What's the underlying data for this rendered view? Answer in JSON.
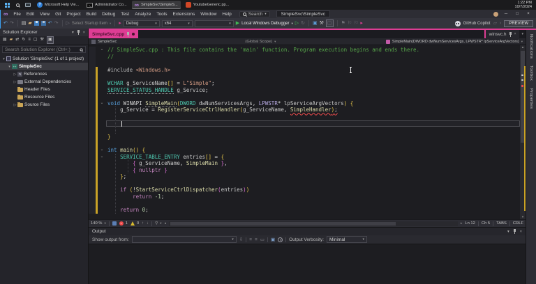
{
  "taskbar": {
    "apps": [
      {
        "label": "Microsoft Help Vie...",
        "icon": "help-viewer",
        "active": false
      },
      {
        "label": "Administrator Co...",
        "icon": "console",
        "active": false
      },
      {
        "label": "SimpleSvc\\SimpleS...",
        "icon": "visual-studio",
        "active": true
      },
      {
        "label": "YoutubeGeneric.pp...",
        "icon": "red-app",
        "active": false
      }
    ],
    "clock": {
      "time": "1:22 PM",
      "date": "10/7/2024"
    }
  },
  "titlebar": {
    "menus": [
      "File",
      "Edit",
      "View",
      "Git",
      "Project",
      "Build",
      "Debug",
      "Test",
      "Analyze",
      "Tools",
      "Extensions",
      "Window",
      "Help"
    ],
    "search_label": "Search",
    "window_title": "SimpleSvc\\SimpleSvc"
  },
  "toolbar": {
    "select_startup": "Select Startup Item",
    "config": "Debug",
    "platform": "x64",
    "run": "Local Windows Debugger",
    "copilot": "GitHub Copilot",
    "preview": "PREVIEW"
  },
  "solution_explorer": {
    "title": "Solution Explorer",
    "search_placeholder": "Search Solution Explorer (Ctrl+;)",
    "tree": [
      {
        "label": "Solution 'SimpleSvc' (1 of 1 project)",
        "icon": "solution",
        "indent": 0,
        "chevron": "down",
        "selected": false
      },
      {
        "label": "SimpleSvc",
        "icon": "cpp-project",
        "indent": 1,
        "chevron": "down",
        "selected": true
      },
      {
        "label": "References",
        "icon": "references",
        "indent": 2,
        "chevron": "right",
        "selected": false
      },
      {
        "label": "External Dependencies",
        "icon": "external-deps",
        "indent": 2,
        "chevron": "right",
        "selected": false
      },
      {
        "label": "Header Files",
        "icon": "folder",
        "indent": 2,
        "chevron": "none",
        "selected": false
      },
      {
        "label": "Resource Files",
        "icon": "folder",
        "indent": 2,
        "chevron": "none",
        "selected": false
      },
      {
        "label": "Source Files",
        "icon": "folder",
        "indent": 2,
        "chevron": "right",
        "selected": false
      }
    ]
  },
  "editor": {
    "tabs": {
      "active": "SimpleSvc.cpp",
      "preview": "winsvc.h"
    },
    "breadcrumb": {
      "project": "SimpleSvc",
      "scope": "(Global Scope)",
      "member": "SimpleMain(DWORD dwNumServicesArgs, LPWSTR* lpServiceArgVectors)"
    },
    "lines": [
      {
        "fold": true,
        "ch": false,
        "t": [
          [
            "c",
            "// SimpleSvc.cpp : This file contains the 'main' function. Program execution begins and ends there."
          ]
        ]
      },
      {
        "ch": false,
        "t": [
          [
            "c",
            "//"
          ]
        ]
      },
      {
        "ch": false,
        "t": []
      },
      {
        "ch": true,
        "t": [
          [
            "pp",
            "#include "
          ],
          [
            "s",
            "<Windows.h>"
          ]
        ]
      },
      {
        "ch": true,
        "t": []
      },
      {
        "ch": true,
        "t": [
          [
            "t",
            "WCHAR"
          ],
          [
            "p",
            " "
          ],
          [
            "id",
            "g_ServiceName"
          ],
          [
            "b1",
            "[]"
          ],
          [
            "p",
            " = "
          ],
          [
            "s",
            "L\"Simple\""
          ],
          [
            "p",
            ";"
          ]
        ]
      },
      {
        "ch": true,
        "t": [
          [
            "t u2",
            "SERVICE_STATUS_HANDLE"
          ],
          [
            "p",
            " "
          ],
          [
            "id",
            "g_Service"
          ],
          [
            "p",
            ";"
          ]
        ]
      },
      {
        "ch": true,
        "t": []
      },
      {
        "fold": true,
        "ch": true,
        "t": [
          [
            "k",
            "void"
          ],
          [
            "p",
            " WINAPI "
          ],
          [
            "f u2",
            "SimpleMain"
          ],
          [
            "b1",
            "("
          ],
          [
            "t",
            "DWORD"
          ],
          [
            "p",
            " "
          ],
          [
            "id",
            "dwNumServicesArgs"
          ],
          [
            "p",
            ", "
          ],
          [
            "m",
            "LPWSTR"
          ],
          [
            "p",
            "* "
          ],
          [
            "id",
            "lpServiceArgVectors"
          ],
          [
            "b1",
            ")"
          ],
          [
            "p",
            " "
          ],
          [
            "b1",
            "{"
          ]
        ]
      },
      {
        "ch": true,
        "t": [
          [
            "p",
            "    "
          ],
          [
            "id",
            "g_Service"
          ],
          [
            "p",
            " = "
          ],
          [
            "f",
            "RegisterServiceCtrlHandler"
          ],
          [
            "b1",
            "("
          ],
          [
            "id",
            "g_ServiceName"
          ],
          [
            "p",
            ", "
          ],
          [
            "f uerr",
            "SimpleHandler"
          ],
          [
            "b1 uerr",
            ")"
          ],
          [
            "p uerr",
            ";"
          ]
        ]
      },
      {
        "ch": true,
        "t": []
      },
      {
        "ch": true,
        "caret": true,
        "t": []
      },
      {
        "ch": true,
        "t": []
      },
      {
        "ch": true,
        "t": [
          [
            "b1",
            "}"
          ]
        ]
      },
      {
        "ch": true,
        "t": []
      },
      {
        "fold": true,
        "ch": true,
        "t": [
          [
            "k",
            "int"
          ],
          [
            "p",
            " "
          ],
          [
            "f",
            "main"
          ],
          [
            "b1",
            "()"
          ],
          [
            "p",
            " "
          ],
          [
            "b1",
            "{"
          ]
        ]
      },
      {
        "fold": true,
        "ch": true,
        "t": [
          [
            "p",
            "    "
          ],
          [
            "t",
            "SERVICE_TABLE_ENTRY"
          ],
          [
            "p",
            " "
          ],
          [
            "id",
            "entries"
          ],
          [
            "b1",
            "[]"
          ],
          [
            "p",
            " = "
          ],
          [
            "b1",
            "{"
          ]
        ]
      },
      {
        "ch": true,
        "t": [
          [
            "p",
            "        "
          ],
          [
            "b2",
            "{"
          ],
          [
            "p",
            " "
          ],
          [
            "id",
            "g_ServiceName"
          ],
          [
            "p",
            ", "
          ],
          [
            "f",
            "SimpleMain"
          ],
          [
            "p",
            " "
          ],
          [
            "b2",
            "}"
          ],
          [
            "p",
            ","
          ]
        ]
      },
      {
        "ch": true,
        "t": [
          [
            "p",
            "        "
          ],
          [
            "b2",
            "{"
          ],
          [
            "p",
            " "
          ],
          [
            "ctl",
            "nullptr"
          ],
          [
            "p",
            " "
          ],
          [
            "b2",
            "}"
          ]
        ]
      },
      {
        "ch": true,
        "t": [
          [
            "p",
            "    "
          ],
          [
            "b1",
            "}"
          ],
          [
            "p",
            ";"
          ]
        ]
      },
      {
        "ch": true,
        "t": []
      },
      {
        "ch": true,
        "t": [
          [
            "p",
            "    "
          ],
          [
            "ctl",
            "if"
          ],
          [
            "p",
            " "
          ],
          [
            "b1",
            "("
          ],
          [
            "p",
            "!"
          ],
          [
            "f",
            "StartServiceCtrlDispatcher"
          ],
          [
            "b2",
            "("
          ],
          [
            "id",
            "entries"
          ],
          [
            "b2",
            ")"
          ],
          [
            "b1",
            ")"
          ]
        ]
      },
      {
        "ch": true,
        "t": [
          [
            "p",
            "        "
          ],
          [
            "ctl",
            "return"
          ],
          [
            "p",
            " "
          ],
          [
            "n",
            "-1"
          ],
          [
            "p",
            ";"
          ]
        ]
      },
      {
        "ch": true,
        "t": []
      },
      {
        "ch": true,
        "t": [
          [
            "p",
            "    "
          ],
          [
            "ctl",
            "return"
          ],
          [
            "p",
            " "
          ],
          [
            "n",
            "0"
          ],
          [
            "p",
            ";"
          ]
        ]
      }
    ],
    "status": {
      "zoom": "140 %",
      "errors": "1",
      "warnings": "0",
      "line": "Ln 12",
      "column": "Ch 5",
      "indent": "TABS",
      "eol": "CRLF"
    }
  },
  "output": {
    "title": "Output",
    "show_from_label": "Show output from:",
    "show_from_value": "",
    "verbosity_label": "Output Verbosity:",
    "verbosity_value": "Minimal"
  },
  "right_rail": [
    "Notifications",
    "Toolbox",
    "Properties"
  ]
}
